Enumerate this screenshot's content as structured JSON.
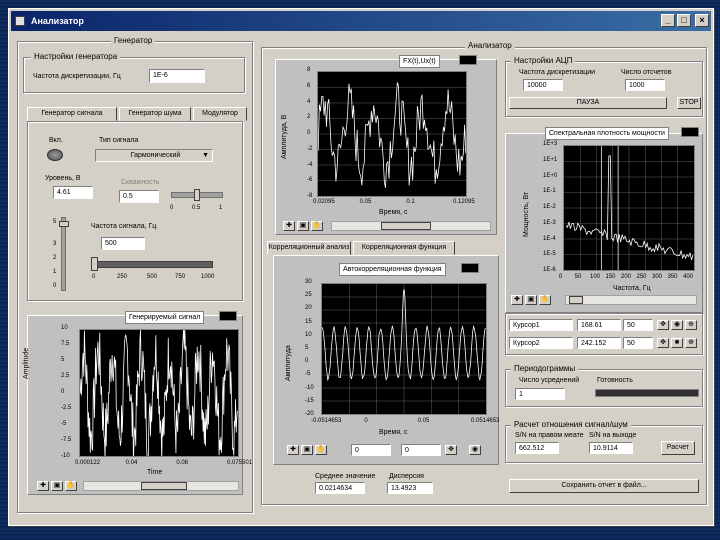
{
  "window": {
    "title": "Анализатор"
  },
  "generator": {
    "panel_title": "Генератор",
    "settings_title": "Настройки генератора",
    "fs_label": "Частота дискретизации, Гц",
    "fs_value": "1E-6",
    "tabs": [
      "Генератор сигнала",
      "Генератор шума",
      "Модулятор"
    ],
    "power_label": "Вкл.",
    "wave_type_label": "Тип сигнала",
    "wave_type_value": "Гармонический",
    "level_label": "Уровень, В",
    "level_value": "4.61",
    "duty_label": "Скважность",
    "duty_value": "0.5",
    "duty_ticks": [
      "0",
      "0.5",
      "1"
    ],
    "freq_label": "Частота сигнала, Гц",
    "freq_value": "500",
    "level_scale": [
      "5",
      "3",
      "2",
      "1",
      "0"
    ],
    "freq_scale": [
      "0",
      "250",
      "500",
      "750",
      "1000"
    ]
  },
  "gen_chart": {
    "title": "Генерируемый сигнал",
    "ylabel": "Amplitude",
    "xlabel": "Time",
    "yticks": [
      "10",
      "7.5",
      "5",
      "2.5",
      "0",
      "-2.5",
      "-5",
      "-7.5",
      "-10"
    ],
    "xticks": [
      "0.000122",
      "0.04",
      "0.08",
      "0.075501"
    ]
  },
  "analyzer": {
    "panel_title": "Анализатор",
    "adc_title": "Настройки АЦП",
    "adc_fs_label": "Частота дискретизации",
    "adc_fs_value": "10000",
    "adc_n_label": "Число отсчетов",
    "adc_n_value": "1000",
    "pause_label": "ПАУЗА",
    "stop_label": "STOP",
    "tabs": [
      "Корреляционный анализ",
      "Корреляционная функция"
    ],
    "mean_label": "Среднее значение",
    "mean_value": "0.0214634",
    "var_label": "Дисперсия",
    "var_value": "13.4923",
    "cursor_rows": [
      {
        "name": "Курсор1",
        "x": "168.61",
        "y": "50"
      },
      {
        "name": "Курсор2",
        "x": "242.152",
        "y": "50"
      }
    ],
    "periodogram_title": "Периодограммы",
    "avg_label": "Число усреднений",
    "avg_value": "1",
    "progress_label": "Готовность",
    "snr_title": "Расчет отношения сигнал/шум",
    "snr_in_label": "S/N на правом меате",
    "snr_in_value": "662.512",
    "snr_out_label": "S/N на выходе",
    "snr_out_value": "10.9114",
    "calc_label": "Расчет",
    "save_label": "Сохранить отчет в файл...",
    "corr_small_fields": [
      "0",
      "0"
    ]
  },
  "signal_chart": {
    "title": "FX(t),Ux(t)",
    "ylabel": "Амплитуда, В",
    "xlabel": "Время, с",
    "yticks": [
      "8",
      "6",
      "4",
      "2",
      "0",
      "-2",
      "-4",
      "-6",
      "-8"
    ],
    "xticks": [
      "0.02095",
      "0.05",
      "0.1",
      "0.12095"
    ]
  },
  "corr_chart": {
    "title": "Автокорреляционная функция",
    "ylabel": "Амплитуда",
    "xlabel": "Время, с",
    "yticks": [
      "30",
      "25",
      "20",
      "15",
      "10",
      "5",
      "0",
      "-5",
      "-10",
      "-15",
      "-20"
    ],
    "xticks": [
      "-0.0514653",
      "0",
      "0.05",
      "0.0514653"
    ]
  },
  "spectrum_chart": {
    "title": "Спектральная плотность мощности",
    "ylabel": "Мощность, Вт",
    "xlabel": "Частота, Гц",
    "yticks": [
      "1E+3",
      "1E+1",
      "1E+0",
      "1E-1",
      "1E-2",
      "1E-3",
      "1E-4",
      "1E-5",
      "1E-6"
    ],
    "xticks": [
      "0",
      "50",
      "100",
      "150",
      "200",
      "250",
      "300",
      "350",
      "400"
    ]
  },
  "colors": {
    "plot_bg": "#000000",
    "trace": "#ffffff",
    "panel": "#d4d0c8",
    "title_bar": "#0a246a"
  }
}
